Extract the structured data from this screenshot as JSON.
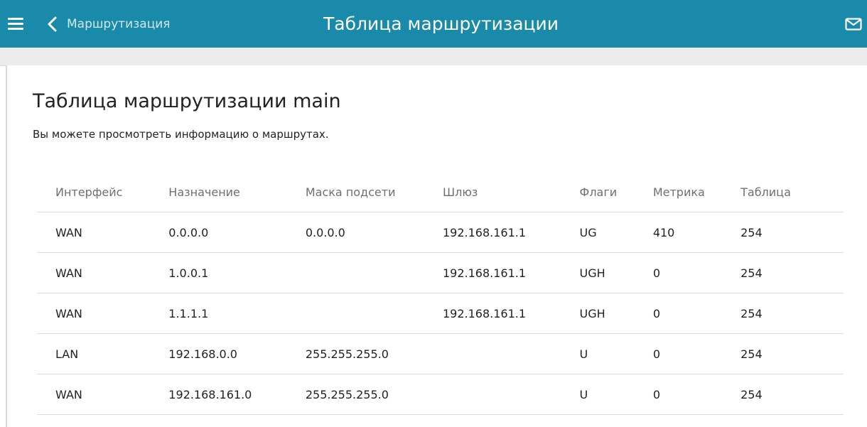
{
  "header": {
    "back_label": "Маршрутизация",
    "title": "Таблица маршрутизации",
    "background_color": "#198aa9"
  },
  "icons": {
    "menu": "hamburger-menu-icon",
    "back": "chevron-left-icon",
    "mail": "envelope-icon"
  },
  "section": {
    "title": "Таблица маршрутизации main",
    "description": "Вы можете просмотреть информацию о маршрутах."
  },
  "table": {
    "columns": [
      "Интерфейс",
      "Назначение",
      "Маска подсети",
      "Шлюз",
      "Флаги",
      "Метрика",
      "Таблица"
    ],
    "rows": [
      [
        "WAN",
        "0.0.0.0",
        "0.0.0.0",
        "192.168.161.1",
        "UG",
        "410",
        "254"
      ],
      [
        "WAN",
        "1.0.0.1",
        "",
        "192.168.161.1",
        "UGH",
        "0",
        "254"
      ],
      [
        "WAN",
        "1.1.1.1",
        "",
        "192.168.161.1",
        "UGH",
        "0",
        "254"
      ],
      [
        "LAN",
        "192.168.0.0",
        "255.255.255.0",
        "",
        "U",
        "0",
        "254"
      ],
      [
        "WAN",
        "192.168.161.0",
        "255.255.255.0",
        "",
        "U",
        "0",
        "254"
      ]
    ]
  }
}
